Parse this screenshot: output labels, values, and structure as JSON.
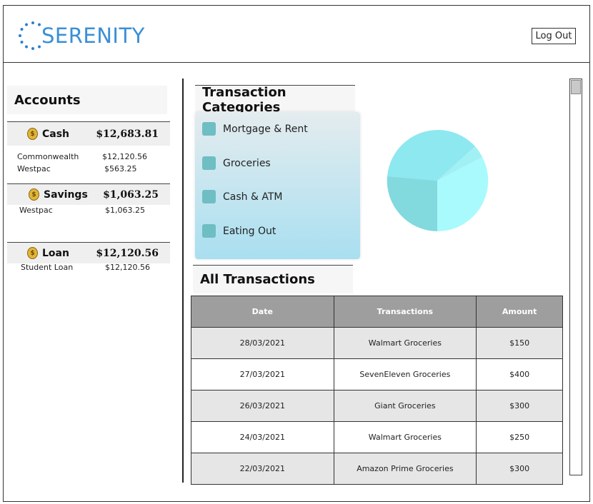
{
  "app": {
    "logo_text": "SERENITY",
    "logout_label": "Log Out"
  },
  "accounts": {
    "title": "Accounts",
    "groups": [
      {
        "name": "Cash",
        "total": "$12,683.81",
        "items": [
          {
            "name": "Commonwealth",
            "amount": "$12,120.56"
          },
          {
            "name": "Westpac",
            "amount": "$563.25"
          }
        ]
      },
      {
        "name": "Savings",
        "total": "$1,063.25",
        "items": [
          {
            "name": "Westpac",
            "amount": "$1,063.25"
          }
        ]
      },
      {
        "name": "Loan",
        "total": "$12,120.56",
        "items": [
          {
            "name": "Student Loan",
            "amount": "$12,120.56"
          }
        ]
      }
    ]
  },
  "categories": {
    "title": "Transaction Categories",
    "items": [
      "Mortgage & Rent",
      "Groceries",
      "Cash & ATM",
      "Eating Out"
    ]
  },
  "transactions": {
    "title": "All Transactions",
    "columns": [
      "Date",
      "Transactions",
      "Amount"
    ],
    "rows": [
      [
        "28/03/2021",
        "Walmart Groceries",
        "$150"
      ],
      [
        "27/03/2021",
        "SevenEleven Groceries",
        "$400"
      ],
      [
        "26/03/2021",
        "Giant Groceries",
        "$300"
      ],
      [
        "24/03/2021",
        "Walmart Groceries",
        "$250"
      ],
      [
        "22/03/2021",
        "Amazon Prime Groceries",
        "$300"
      ]
    ]
  },
  "icons": {
    "coin": "money-bag-icon",
    "logo": "dotted-circle-logo-icon"
  },
  "colors": {
    "brand": "#3a8fd6",
    "legend_swatch": "#6ebec3",
    "table_header": "#9e9e9e"
  }
}
